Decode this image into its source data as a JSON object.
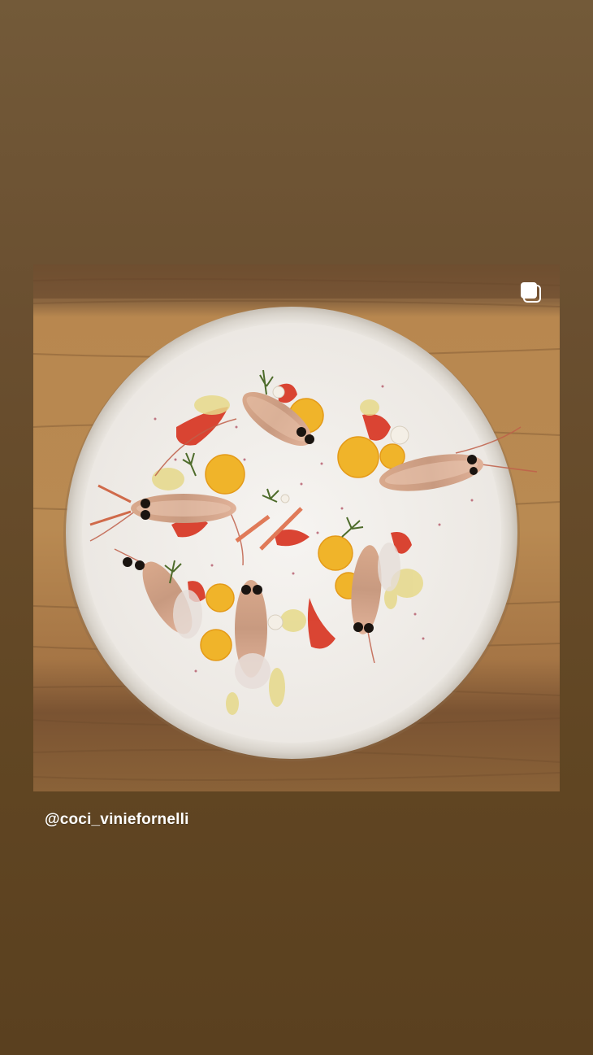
{
  "story": {
    "mention": "@coci_viniefornelli",
    "background_top": "#735a39",
    "background_bottom": "#5a401f"
  },
  "post": {
    "content": "photo",
    "multi_photo_icon": "carousel-icon"
  }
}
